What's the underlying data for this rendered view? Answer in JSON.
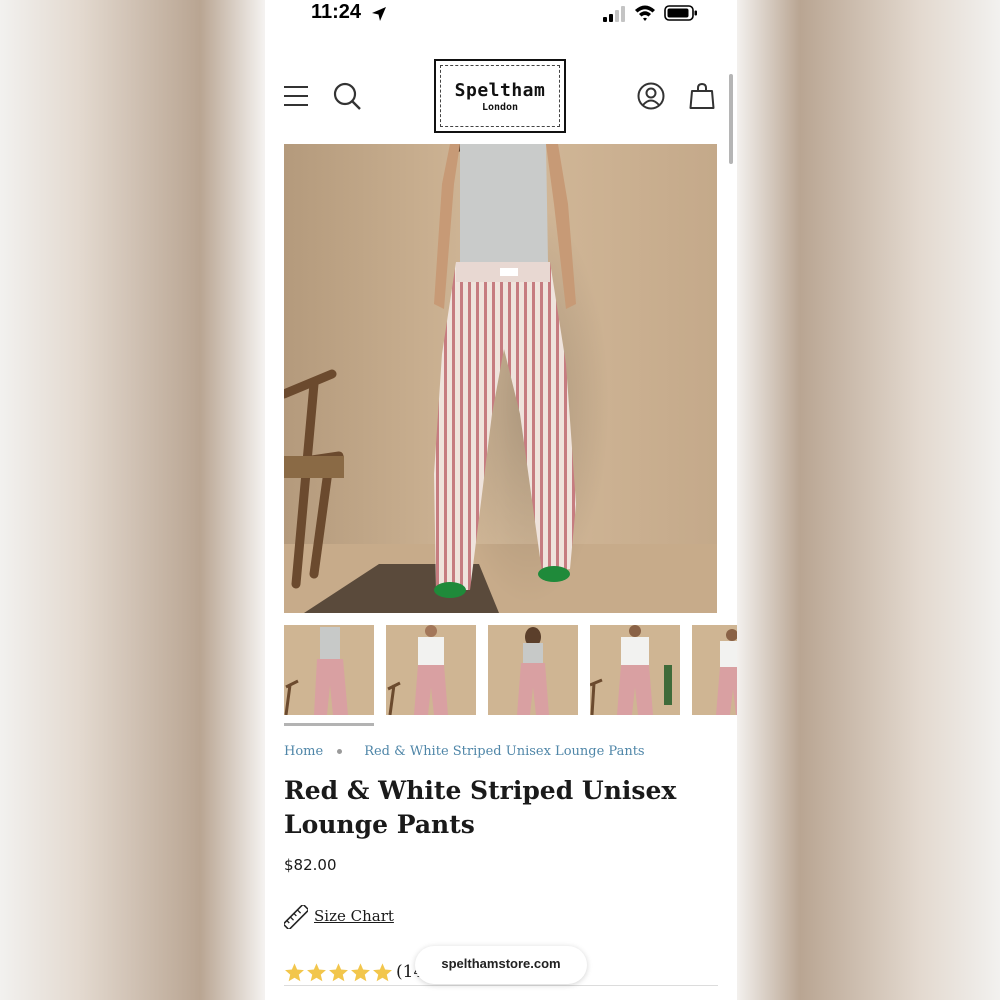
{
  "status_bar": {
    "time": "11:24"
  },
  "header": {
    "logo": {
      "name": "Speltham",
      "subtitle": "London"
    }
  },
  "icons": {
    "menu": "hamburger-menu-icon",
    "search": "search-icon",
    "account": "account-icon",
    "cart": "shopping-bag-icon",
    "size_chart": "ruler-icon",
    "rating": "star-icon"
  },
  "gallery": {
    "thumbnail_count": 5,
    "active_index": 0
  },
  "breadcrumb": {
    "home": "Home",
    "current": "Red & White Striped Unisex Lounge Pants"
  },
  "product": {
    "title": "Red & White Striped Unisex Lounge Pants",
    "price": "$82.00",
    "size_chart_label": "Size Chart",
    "rating": {
      "stars": 5,
      "count_text": "(14"
    }
  },
  "browser": {
    "url": "spelthamstore.com"
  },
  "colors": {
    "link": "#4f86a8",
    "star": "#f2c64c",
    "text": "#1a1a1a",
    "backdrop": "#d9c8b6"
  }
}
